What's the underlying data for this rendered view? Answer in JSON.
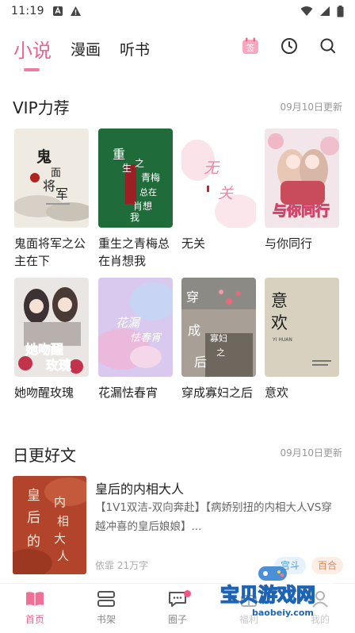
{
  "status_bar": {
    "time": "11:19"
  },
  "header": {
    "tabs": [
      {
        "label": "小说",
        "active": true
      },
      {
        "label": "漫画",
        "active": false
      },
      {
        "label": "听书",
        "active": false
      }
    ],
    "signin_label": "签",
    "icons": [
      "signin-icon",
      "history-clock-icon",
      "search-icon"
    ]
  },
  "vip_section": {
    "title": "VIP力荐",
    "date": "09月10日更新",
    "books": [
      {
        "title": "鬼面将军之公主在下",
        "cover_text": "鬼面将军"
      },
      {
        "title": "重生之青梅总在肖想我",
        "cover_text": "重生之青梅总在肖想我"
      },
      {
        "title": "无关",
        "cover_text": "无关"
      },
      {
        "title": "与你同行",
        "cover_text": "与你同行"
      },
      {
        "title": "她吻醒玫瑰",
        "cover_text": "她吻醒玫瑰"
      },
      {
        "title": "花漏怯春宵",
        "cover_text": "花漏怯春宵"
      },
      {
        "title": "穿成寡妇之后",
        "cover_text": "穿成寡妇之后"
      },
      {
        "title": "意欢",
        "cover_text": "意欢",
        "cover_subtext": "YI HUAN"
      }
    ]
  },
  "daily_section": {
    "title": "日更好文",
    "date": "09月10日更新",
    "book": {
      "title": "皇后的内相大人",
      "description": "【1V1双洁-双向奔赴】【病娇别扭的内相大人VS穿越冲喜的皇后娘娘】...",
      "meta": "依霏 21万字",
      "tags": [
        "宫斗",
        "百合"
      ],
      "cover_text": "皇后的内相大人"
    }
  },
  "bottom_nav": {
    "items": [
      {
        "label": "首页",
        "icon": "book-open-icon",
        "active": true
      },
      {
        "label": "书架",
        "icon": "bookshelf-icon",
        "active": false
      },
      {
        "label": "圈子",
        "icon": "chat-bubble-icon",
        "active": false,
        "badge": true
      },
      {
        "label": "福利",
        "icon": "gift-icon",
        "active": false
      },
      {
        "label": "我的",
        "icon": "profile-icon",
        "active": false
      }
    ]
  },
  "watermark": {
    "text": "宝贝游戏网",
    "url": "baobeiy.com"
  },
  "colors": {
    "accent": "#e8658f",
    "text": "#222222",
    "muted": "#999999"
  }
}
